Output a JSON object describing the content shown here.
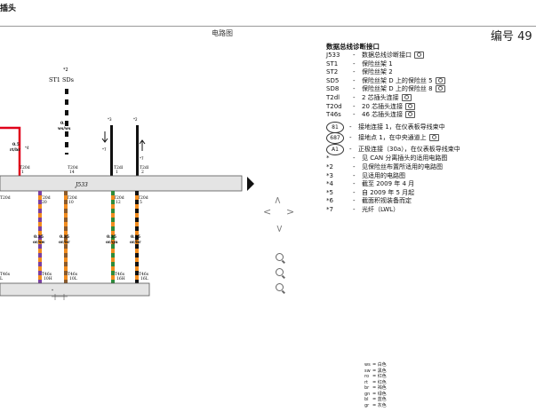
{
  "header": {
    "title": "插头",
    "diagram_label": "电路图",
    "doc_number": "编号 49"
  },
  "diagram": {
    "top_marker": "*2",
    "top_label": "ST1  SDs",
    "bus_label": "J533",
    "bottom_marker": "*",
    "wires": [
      {
        "id": "w1",
        "gauge": "0.5",
        "color_code": "ws/ws",
        "connector": "T20d",
        "pin": "14",
        "marker": ""
      },
      {
        "id": "w2",
        "gauge": "0.5",
        "color_code": "rt/br",
        "connector": "T20d",
        "pin": "1",
        "marker": "*4"
      },
      {
        "id": "w3",
        "gauge": "",
        "color_code": "",
        "connector": "T2dl",
        "pin": "1",
        "marker": "*3"
      },
      {
        "id": "w4",
        "gauge": "",
        "color_code": "",
        "connector": "T2dl",
        "pin": "2",
        "marker": "*2"
      }
    ],
    "up_labels": [
      "*7",
      "*7"
    ],
    "upper_connectors": [
      {
        "name": "T20d",
        "pin": "20"
      },
      {
        "name": "T20d",
        "pin": "10"
      },
      {
        "name": "T20d",
        "pin": "12"
      },
      {
        "name": "T20d",
        "pin": "5"
      }
    ],
    "left_upper_connector": {
      "name": "T20d",
      "pin": ""
    },
    "lower_wires": [
      {
        "gauge": "0.35",
        "color_code": "or/sw"
      },
      {
        "gauge": "0.35",
        "color_code": "or/br"
      },
      {
        "gauge": "0.35",
        "color_code": "or/gn"
      },
      {
        "gauge": "0.35",
        "color_code": "or/br"
      }
    ],
    "lower_connectors": [
      {
        "name": "T46s",
        "pin": "10H"
      },
      {
        "name": "T46s",
        "pin": "10L"
      },
      {
        "name": "T46s",
        "pin": "16H"
      },
      {
        "name": "T46s",
        "pin": "16L"
      }
    ],
    "left_lower_connector": {
      "name": "T46s",
      "pin": "L"
    }
  },
  "legend": {
    "title": "数据总线诊断接口",
    "items": [
      {
        "code": "J533",
        "dash": "-",
        "text": "数据总线诊断接口",
        "camera": true
      },
      {
        "code": "ST1",
        "dash": "-",
        "text": "保险丝架 1",
        "camera": false
      },
      {
        "code": "ST2",
        "dash": "-",
        "text": "保险丝架 2",
        "camera": false
      },
      {
        "code": "SD5",
        "dash": "-",
        "text": "保险丝架 D 上的保险丝 5",
        "camera": true
      },
      {
        "code": "SD8",
        "dash": "-",
        "text": "保险丝架 D 上的保险丝 8",
        "camera": true
      },
      {
        "code": "T2dl",
        "dash": "-",
        "text": "2 芯插头连接",
        "camera": true
      },
      {
        "code": "T20d",
        "dash": "-",
        "text": "20 芯插头连接",
        "camera": true
      },
      {
        "code": "T46s",
        "dash": "-",
        "text": "46 芯插头连接",
        "camera": true
      }
    ],
    "circle_items": [
      {
        "code": "81",
        "dash": "-",
        "text": "接地连接 1，在仪表板导线束中",
        "camera": false
      },
      {
        "code": "687",
        "dash": "-",
        "text": "接地点 1，在中央通道上",
        "camera": true
      },
      {
        "code": "A1",
        "dash": "-",
        "text": "正极连接（30a），在仪表板导线束中",
        "camera": false
      }
    ],
    "notes": [
      {
        "code": "*",
        "dash": "-",
        "text": "见 CAN 分离插头的适用电路图"
      },
      {
        "code": "*2",
        "dash": "-",
        "text": "见保险丝布置所适用的电路图"
      },
      {
        "code": "*3",
        "dash": "-",
        "text": "见适用的电路图"
      },
      {
        "code": "*4",
        "dash": "-",
        "text": "截至 2009 年 4 月"
      },
      {
        "code": "*5",
        "dash": "-",
        "text": "自 2009 年 5 月起"
      },
      {
        "code": "*6",
        "dash": "-",
        "text": "截面积视装备而定"
      },
      {
        "code": "*7",
        "dash": "-",
        "text": "光纤（LWL）"
      }
    ]
  },
  "abbreviations": [
    {
      "key": "ws",
      "val": "= 白色"
    },
    {
      "key": "sw",
      "val": "= 黑色"
    },
    {
      "key": "ro",
      "val": "= 红色"
    },
    {
      "key": "rt",
      "val": "= 红色"
    },
    {
      "key": "br",
      "val": "= 褐色"
    },
    {
      "key": "gn",
      "val": "= 绿色"
    },
    {
      "key": "bl",
      "val": "= 蓝色"
    },
    {
      "key": "gr",
      "val": "= 灰色"
    }
  ],
  "colors": {
    "bus_fill": "#e4e4e4",
    "red_wire": "#e0001a",
    "orange": "#f28c1e",
    "violet": "#7b3fa0",
    "green": "#2e8b3a",
    "brown": "#8b5a2b",
    "black": "#111111",
    "yellow": "#f2d21a",
    "purple_stripe": "#b0128a"
  },
  "icons": [
    "chevron-up-icon",
    "chevron-left-icon",
    "chevron-right-icon",
    "chevron-down-icon",
    "zoom-in-icon",
    "zoom-reset-icon",
    "zoom-out-icon",
    "camera-icon",
    "play-triangle-icon"
  ]
}
